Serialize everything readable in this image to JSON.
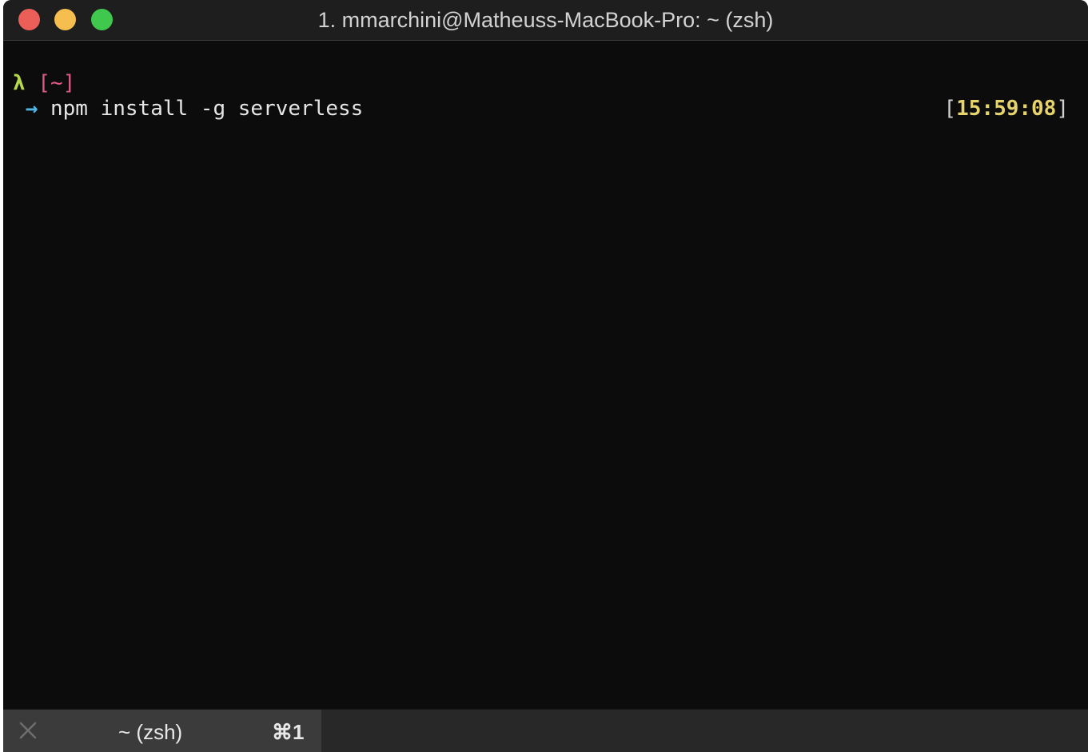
{
  "window": {
    "title": "1. mmarchini@Matheuss-MacBook-Pro: ~ (zsh)"
  },
  "terminal": {
    "prompt_symbol": "λ",
    "cwd_open": "[",
    "cwd": "~",
    "cwd_close": "]",
    "arrow": "→",
    "command": "npm install -g serverless",
    "clock_open": "[",
    "clock_time": "15:59:08",
    "clock_close": "]"
  },
  "tab": {
    "label": "~ (zsh)",
    "shortcut": "⌘1"
  },
  "colors": {
    "prompt_lambda": "#b6d94c",
    "cwd": "#e05a87",
    "arrow": "#4fb7e6",
    "clock_time": "#e6d36a",
    "close_light": "#ec5f58",
    "minimize_light": "#f5be4f",
    "zoom_light": "#3fc84d"
  }
}
